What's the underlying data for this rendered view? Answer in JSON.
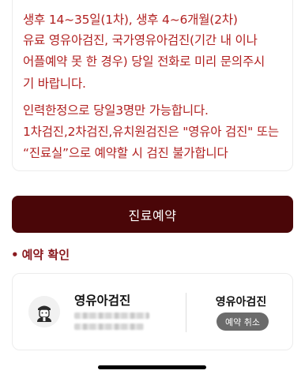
{
  "notice": {
    "lines": [
      "생후 14~35일(1차), 생후 4~6개월(2차)",
      "유료 영유아검진, 국가영유아검진(기간 내 이나",
      "어플예약 못 한 경우) 당일 전화로 미리 문의주시",
      "기 바랍니다.",
      "인력한정으로 당일3명만 가능합니다.",
      "1차검진,2차검진,유치원검진은 \"영유아 검진\" 또는",
      "“진료실”으로 예약할 시 검진 불가합니다"
    ]
  },
  "reserve_button": {
    "label": "진료예약"
  },
  "reservation_section": {
    "bullet": "•",
    "title": "예약 확인"
  },
  "reservation_card": {
    "title": "영유아검진",
    "icon": "doctor-icon",
    "status_title": "영유아검진",
    "cancel_label": "예약 취소"
  },
  "colors": {
    "notice_text": "#b12020",
    "button_bg": "#4a0608",
    "section_title": "#8a1a1f",
    "cancel_bg": "#6b6b6b"
  }
}
